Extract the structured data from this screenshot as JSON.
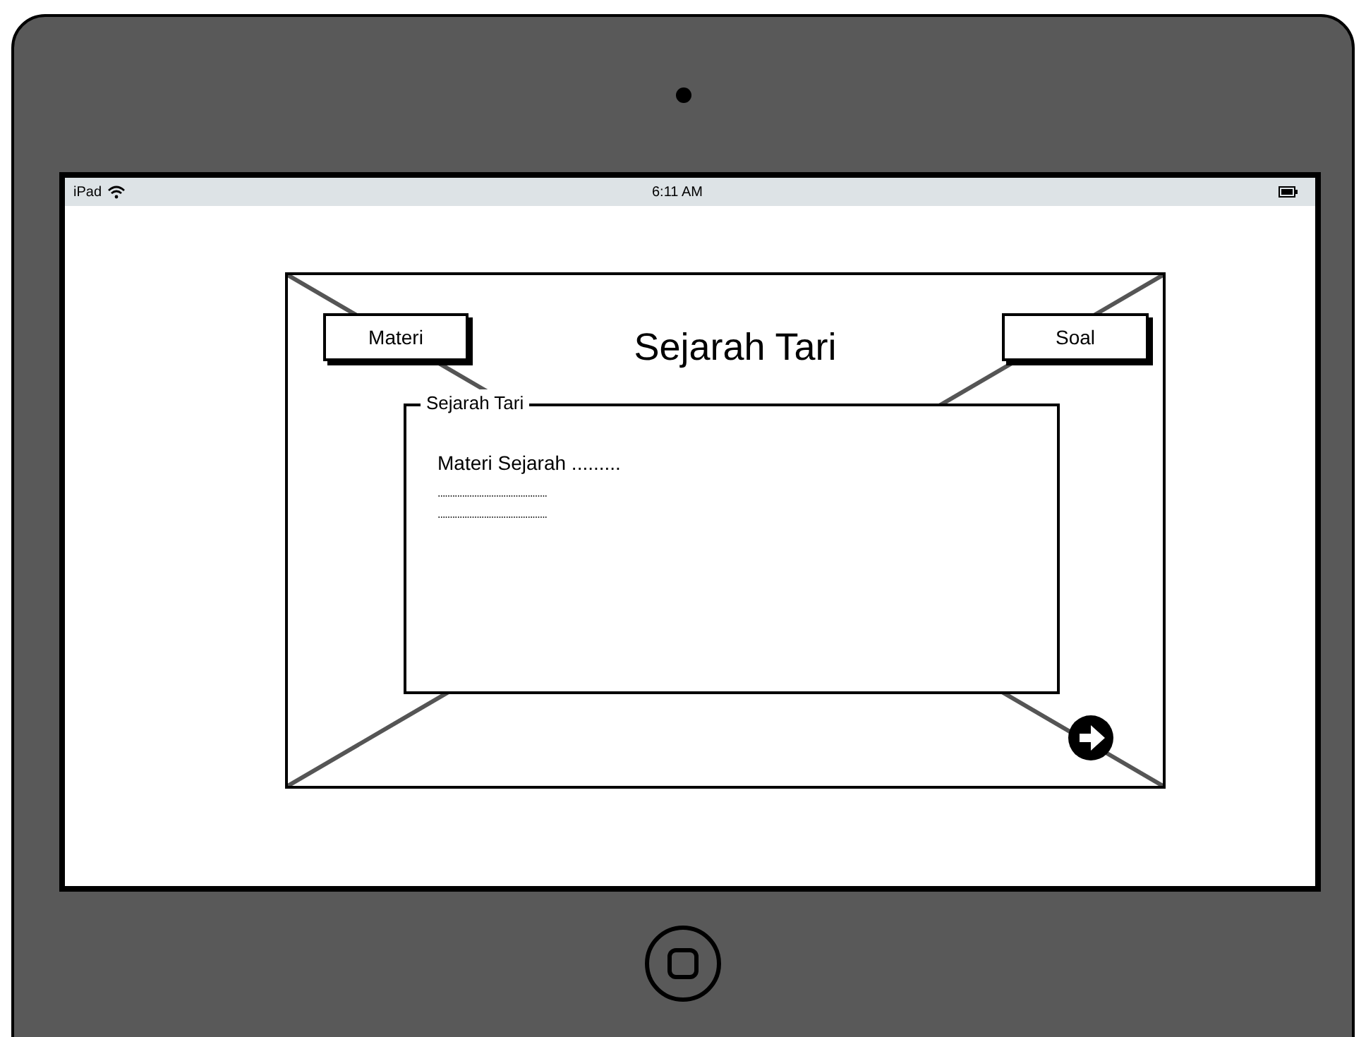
{
  "status_bar": {
    "device": "iPad",
    "time": "6:11 AM"
  },
  "page": {
    "title": "Sejarah Tari",
    "buttons": [
      {
        "label": "Materi"
      },
      {
        "label": "Soal"
      }
    ],
    "panel": {
      "legend": "Sejarah Tari",
      "lines": [
        "Materi Sejarah .........",
        ".............................................",
        "............................................."
      ]
    }
  }
}
